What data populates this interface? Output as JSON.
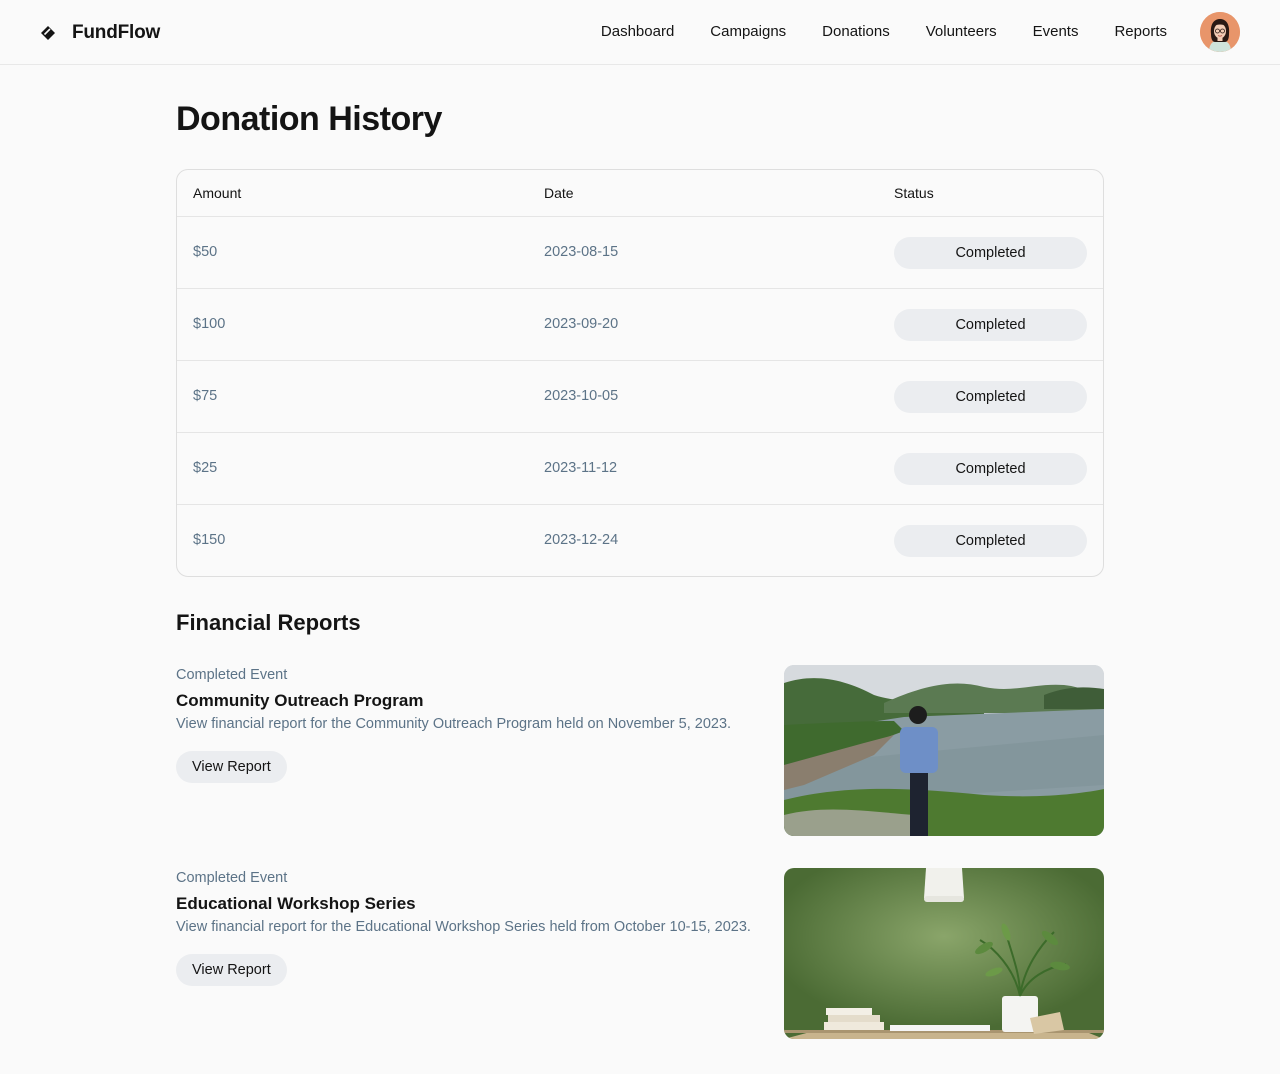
{
  "app": {
    "brand": "FundFlow",
    "nav": [
      "Dashboard",
      "Campaigns",
      "Donations",
      "Volunteers",
      "Events",
      "Reports"
    ]
  },
  "donation_history": {
    "title": "Donation History",
    "columns": [
      "Amount",
      "Date",
      "Status"
    ],
    "rows": [
      {
        "amount": "$50",
        "date": "2023-08-15",
        "status": "Completed"
      },
      {
        "amount": "$100",
        "date": "2023-09-20",
        "status": "Completed"
      },
      {
        "amount": "$75",
        "date": "2023-10-05",
        "status": "Completed"
      },
      {
        "amount": "$25",
        "date": "2023-11-12",
        "status": "Completed"
      },
      {
        "amount": "$150",
        "date": "2023-12-24",
        "status": "Completed"
      }
    ]
  },
  "financial_reports": {
    "title": "Financial Reports",
    "items": [
      {
        "kicker": "Completed Event",
        "title": "Community Outreach Program",
        "description": "View financial report for the Community Outreach Program held on November 5, 2023.",
        "button": "View Report"
      },
      {
        "kicker": "Completed Event",
        "title": "Educational Workshop Series",
        "description": "View financial report for the Educational Workshop Series held from October 10-15, 2023.",
        "button": "View Report"
      }
    ]
  }
}
